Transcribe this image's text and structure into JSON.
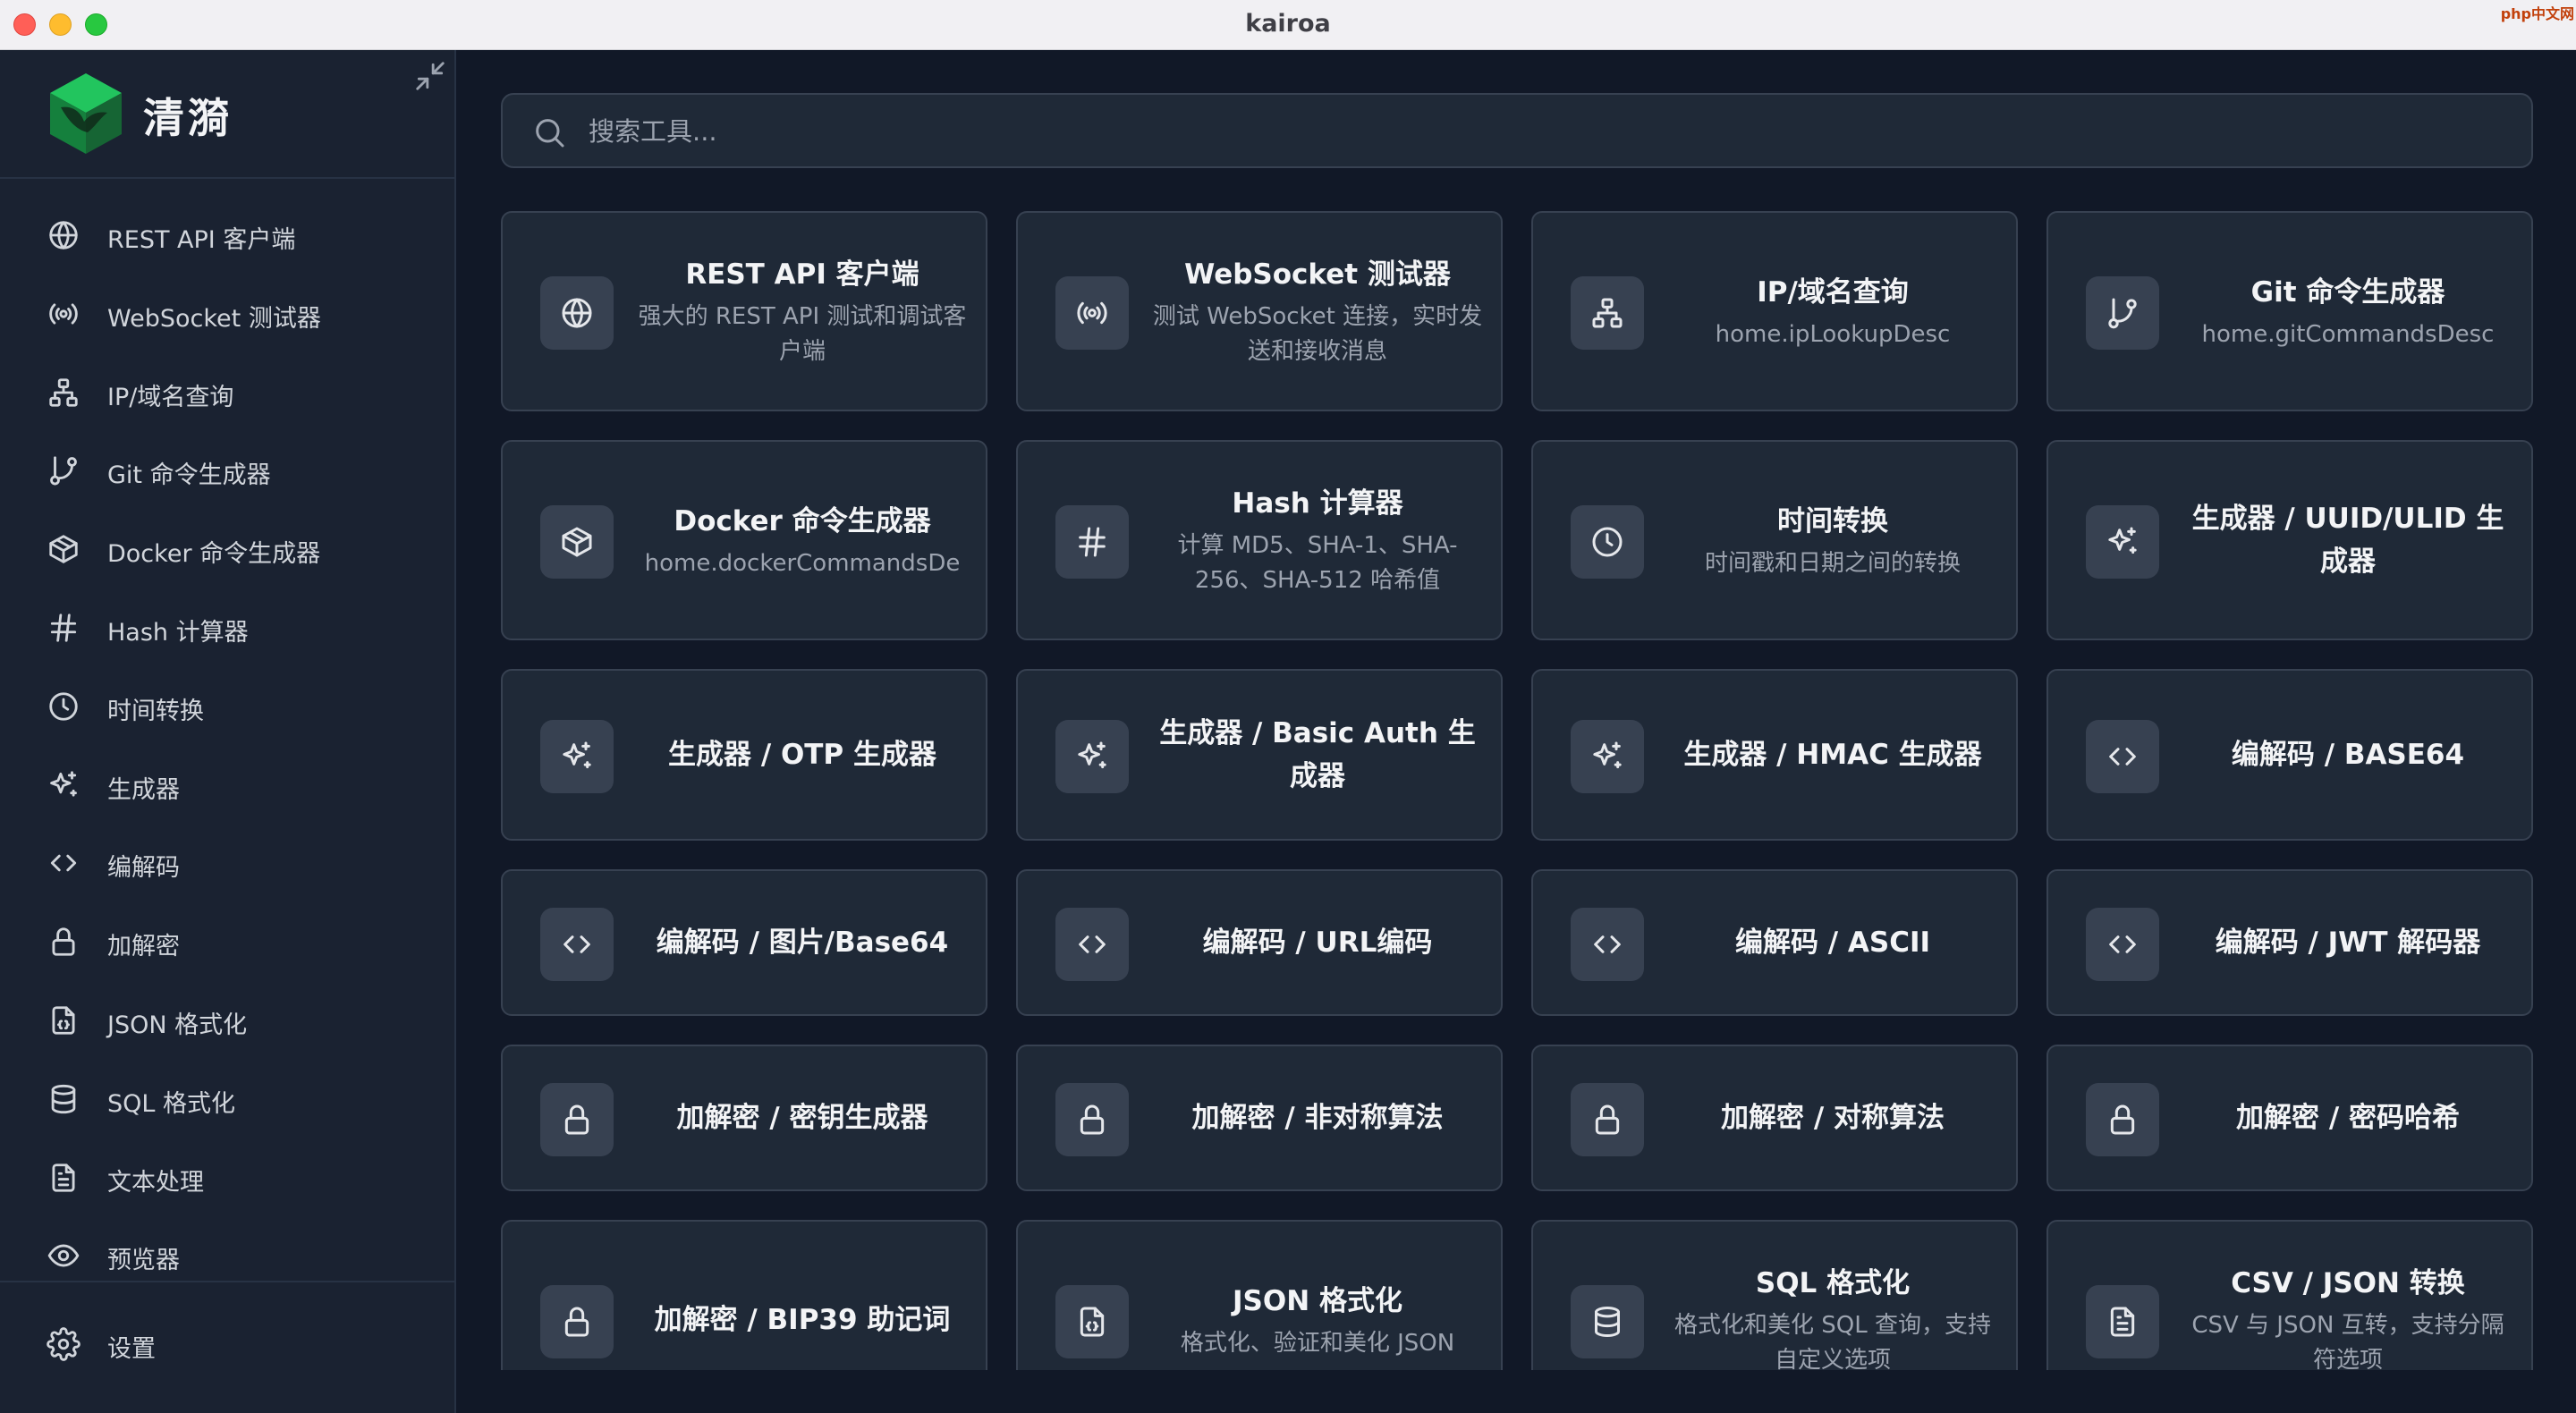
{
  "window": {
    "title": "kairoa",
    "corner_badge": "php中文网"
  },
  "sidebar": {
    "brand_name": "清漪",
    "items": [
      {
        "label": "REST API 客户端",
        "icon": "globe-icon"
      },
      {
        "label": "WebSocket 测试器",
        "icon": "broadcast-icon"
      },
      {
        "label": "IP/域名查询",
        "icon": "network-icon"
      },
      {
        "label": "Git 命令生成器",
        "icon": "git-branch-icon"
      },
      {
        "label": "Docker 命令生成器",
        "icon": "package-icon"
      },
      {
        "label": "Hash 计算器",
        "icon": "hash-icon"
      },
      {
        "label": "时间转换",
        "icon": "clock-icon"
      },
      {
        "label": "生成器",
        "icon": "sparkles-icon"
      },
      {
        "label": "编解码",
        "icon": "code-icon"
      },
      {
        "label": "加解密",
        "icon": "lock-icon"
      },
      {
        "label": "JSON 格式化",
        "icon": "file-json-icon"
      },
      {
        "label": "SQL 格式化",
        "icon": "database-icon"
      },
      {
        "label": "文本处理",
        "icon": "file-text-icon"
      },
      {
        "label": "预览器",
        "icon": "eye-icon"
      }
    ],
    "settings_label": "设置"
  },
  "search": {
    "placeholder": "搜索工具..."
  },
  "cards": [
    {
      "title": "REST API 客户端",
      "desc": "强大的 REST API 测试和调试客户端",
      "icon": "globe-icon"
    },
    {
      "title": "WebSocket 测试器",
      "desc": "测试 WebSocket 连接，实时发送和接收消息",
      "icon": "broadcast-icon"
    },
    {
      "title": "IP/域名查询",
      "desc": "home.ipLookupDesc",
      "icon": "network-icon"
    },
    {
      "title": "Git 命令生成器",
      "desc": "home.gitCommandsDesc",
      "icon": "git-branch-icon"
    },
    {
      "title": "Docker 命令生成器",
      "desc": "home.dockerCommandsDe",
      "icon": "package-icon"
    },
    {
      "title": "Hash 计算器",
      "desc": "计算 MD5、SHA-1、SHA-256、SHA-512 哈希值",
      "icon": "hash-icon"
    },
    {
      "title": "时间转换",
      "desc": "时间戳和日期之间的转换",
      "icon": "clock-icon"
    },
    {
      "title": "生成器 / UUID/ULID 生成器",
      "desc": "",
      "icon": "sparkles-icon"
    },
    {
      "title": "生成器 / OTP 生成器",
      "desc": "",
      "icon": "sparkles-icon"
    },
    {
      "title": "生成器 / Basic Auth 生成器",
      "desc": "",
      "icon": "sparkles-icon"
    },
    {
      "title": "生成器 / HMAC 生成器",
      "desc": "",
      "icon": "sparkles-icon"
    },
    {
      "title": "编解码 / BASE64",
      "desc": "",
      "icon": "code-icon"
    },
    {
      "title": "编解码 / 图片/Base64",
      "desc": "",
      "icon": "code-icon"
    },
    {
      "title": "编解码 / URL编码",
      "desc": "",
      "icon": "code-icon"
    },
    {
      "title": "编解码 / ASCII",
      "desc": "",
      "icon": "code-icon"
    },
    {
      "title": "编解码 / JWT 解码器",
      "desc": "",
      "icon": "code-icon"
    },
    {
      "title": "加解密 / 密钥生成器",
      "desc": "",
      "icon": "lock-icon"
    },
    {
      "title": "加解密 / 非对称算法",
      "desc": "",
      "icon": "lock-icon"
    },
    {
      "title": "加解密 / 对称算法",
      "desc": "",
      "icon": "lock-icon"
    },
    {
      "title": "加解密 / 密码哈希",
      "desc": "",
      "icon": "lock-icon"
    },
    {
      "title": "加解密 / BIP39 助记词",
      "desc": "",
      "icon": "lock-icon"
    },
    {
      "title": "JSON 格式化",
      "desc": "格式化、验证和美化 JSON",
      "icon": "file-json-icon"
    },
    {
      "title": "SQL 格式化",
      "desc": "格式化和美化 SQL 查询，支持自定义选项",
      "icon": "database-icon"
    },
    {
      "title": "CSV / JSON 转换",
      "desc": "CSV 与 JSON 互转，支持分隔符选项",
      "icon": "file-text-icon"
    }
  ],
  "colors": {
    "background": "#111827",
    "sidebar": "#1a2231",
    "card": "#1f2937",
    "border": "#374151",
    "text": "#f3f4f6",
    "muted": "#9ca3af",
    "logo_green": "#16a34a"
  }
}
